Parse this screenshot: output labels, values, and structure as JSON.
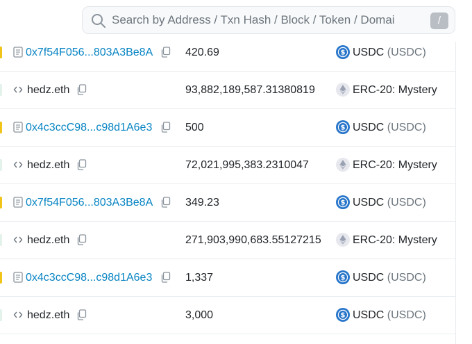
{
  "search": {
    "placeholder": "Search by Address / Txn Hash / Block / Token / Domai",
    "shortcut": "/"
  },
  "rows": [
    {
      "kind": "contract",
      "address": "0x7f54F056...803A3Be8A",
      "amount": "420.69",
      "token_name": "USDC",
      "token_symbol": "(USDC)",
      "token_icon": "usdc-icon"
    },
    {
      "kind": "wallet",
      "address": "hedz.eth",
      "amount": "93,882,189,587.31380819",
      "token_name": "ERC-20: Mystery",
      "token_symbol": "",
      "token_icon": "eth-icon"
    },
    {
      "kind": "contract",
      "address": "0x4c3ccC98...c98d1A6e3",
      "amount": "500",
      "token_name": "USDC",
      "token_symbol": "(USDC)",
      "token_icon": "usdc-icon"
    },
    {
      "kind": "wallet",
      "address": "hedz.eth",
      "amount": "72,021,995,383.2310047",
      "token_name": "ERC-20: Mystery",
      "token_symbol": "",
      "token_icon": "eth-icon"
    },
    {
      "kind": "contract",
      "address": "0x7f54F056...803A3Be8A",
      "amount": "349.23",
      "token_name": "USDC",
      "token_symbol": "(USDC)",
      "token_icon": "usdc-icon"
    },
    {
      "kind": "wallet",
      "address": "hedz.eth",
      "amount": "271,903,990,683.55127215",
      "token_name": "ERC-20: Mystery",
      "token_symbol": "",
      "token_icon": "eth-icon"
    },
    {
      "kind": "contract",
      "address": "0x4c3ccC98...c98d1A6e3",
      "amount": "1,337",
      "token_name": "USDC",
      "token_symbol": "(USDC)",
      "token_icon": "usdc-icon"
    },
    {
      "kind": "wallet",
      "address": "hedz.eth",
      "amount": "3,000",
      "token_name": "USDC",
      "token_symbol": "(USDC)",
      "token_icon": "usdc-icon"
    }
  ],
  "colors": {
    "link": "#0784c3",
    "usdc": "#2775ca",
    "eth_badge": "#e6e8ee",
    "contract_marker": "#f0c419"
  }
}
